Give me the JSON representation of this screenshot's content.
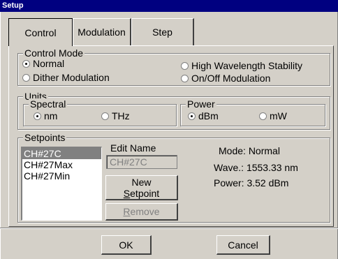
{
  "window": {
    "title": "Setup"
  },
  "tabs": [
    {
      "label": "Control"
    },
    {
      "label": "Modulation"
    },
    {
      "label": "Step"
    }
  ],
  "control_mode": {
    "label": "Control Mode",
    "options": [
      {
        "label": "Normal",
        "checked": true
      },
      {
        "label": "Dither Modulation",
        "checked": false
      },
      {
        "label": "High Wavelength Stability",
        "checked": false
      },
      {
        "label": "On/Off Modulation",
        "checked": false
      }
    ]
  },
  "units": {
    "label": "Units",
    "spectral": {
      "label": "Spectral",
      "options": [
        {
          "label": "nm",
          "checked": true
        },
        {
          "label": "THz",
          "checked": false
        }
      ]
    },
    "power": {
      "label": "Power",
      "options": [
        {
          "label": "dBm",
          "checked": true
        },
        {
          "label": "mW",
          "checked": false
        }
      ]
    }
  },
  "setpoints": {
    "label": "Setpoints",
    "items": [
      {
        "label": "CH#27C",
        "selected": true
      },
      {
        "label": "CH#27Max",
        "selected": false
      },
      {
        "label": "CH#27Min",
        "selected": false
      }
    ],
    "edit_name": {
      "label": "Edit Name",
      "value": "CH#27C"
    },
    "new_button": {
      "line1": "New",
      "line2_underlined": "S",
      "line2_rest": "etpoint"
    },
    "remove_button": {
      "underlined": "R",
      "rest": "emove"
    },
    "info": {
      "mode_label": "Mode:",
      "mode_value": "Normal",
      "wave_label": "Wave.:",
      "wave_value": "1553.33 nm",
      "power_label": "Power:",
      "power_value": "3.52 dBm"
    }
  },
  "footer": {
    "ok_label": "OK",
    "cancel_label": "Cancel"
  }
}
